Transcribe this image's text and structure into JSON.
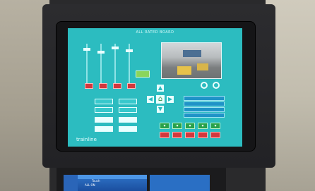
{
  "panel": {
    "title": "ALL RATED BOARD",
    "brand": "trainline"
  },
  "lower_panel": {
    "label": "Touch",
    "row_text": "ALL ON"
  }
}
